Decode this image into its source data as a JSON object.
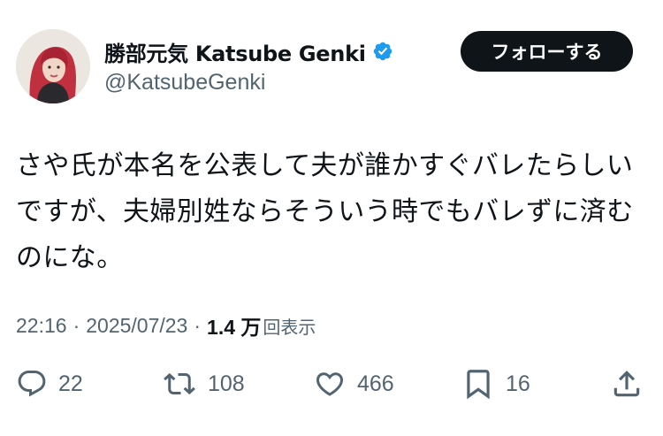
{
  "user": {
    "display_name": "勝部元気 Katsube Genki",
    "handle": "@KatsubeGenki",
    "verified": true
  },
  "follow_button": {
    "label": "フォローする"
  },
  "tweet": {
    "text_lines": [
      "さや氏が本名を公表して夫が誰かすぐバレたらしい",
      "ですが、夫婦別姓ならそういう時でもバレずに済む",
      "のにな。"
    ],
    "time": "22:16",
    "separator": "·",
    "date": "2025/07/23",
    "views_count": "1.4 万",
    "views_suffix": "回表示"
  },
  "actions": {
    "replies": "22",
    "reposts": "108",
    "likes": "466",
    "bookmarks": "16"
  },
  "icons": {
    "reply": "speech-bubble-icon",
    "repost": "repost-arrows-icon",
    "like": "heart-icon",
    "bookmark": "bookmark-icon",
    "share": "share-upload-icon",
    "verified": "verified-badge-icon"
  },
  "colors": {
    "text": "#0f1419",
    "secondary": "#536471",
    "verified": "#1d9bf0",
    "follow_bg": "#0f1419"
  }
}
